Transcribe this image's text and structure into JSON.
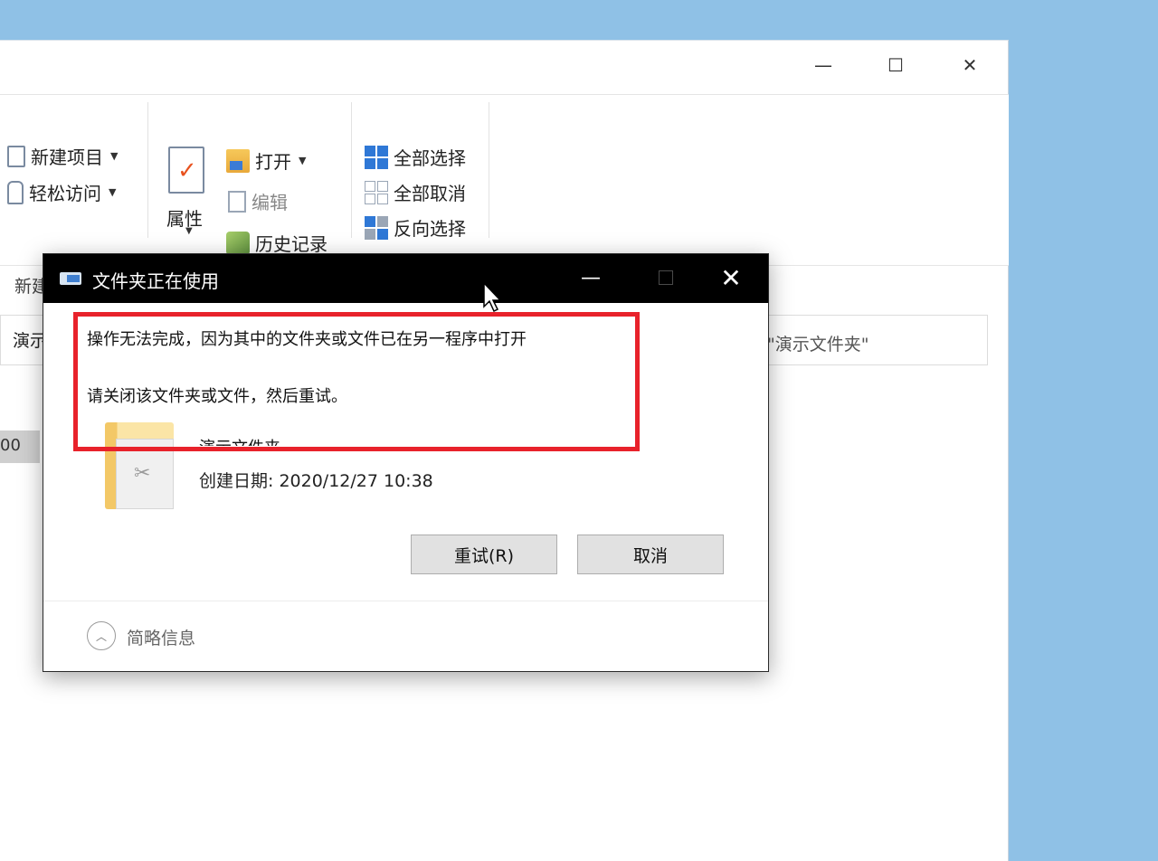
{
  "explorer": {
    "window_controls": {
      "minimize": "—",
      "maximize": "☐",
      "close": "✕"
    },
    "help": "?",
    "ribbon": {
      "new_item": "新建项目",
      "easy_access": "轻松访问",
      "properties": "属性",
      "open": "打开",
      "edit": "编辑",
      "history": "历史记录",
      "select_all": "全部选择",
      "select_none": "全部取消",
      "invert_selection": "反向选择",
      "group_label_fragment": "新建"
    },
    "address_fragment": "演示",
    "search_placeholder": "\"演示文件夹\"",
    "row_fragment": "00"
  },
  "dialog": {
    "title": "文件夹正在使用",
    "message_line1": "操作无法完成，因为其中的文件夹或文件已在另一程序中打开",
    "message_line2": "请关闭该文件夹或文件，然后重试。",
    "file_name": "演示文件夹",
    "created": "创建日期: 2020/12/27 10:38",
    "retry_label": "重试(R)",
    "cancel_label": "取消",
    "details_label": "简略信息"
  },
  "colors": {
    "desktop": "#8fc1e6",
    "highlight": "#e8222b",
    "titlebar": "#000000"
  }
}
